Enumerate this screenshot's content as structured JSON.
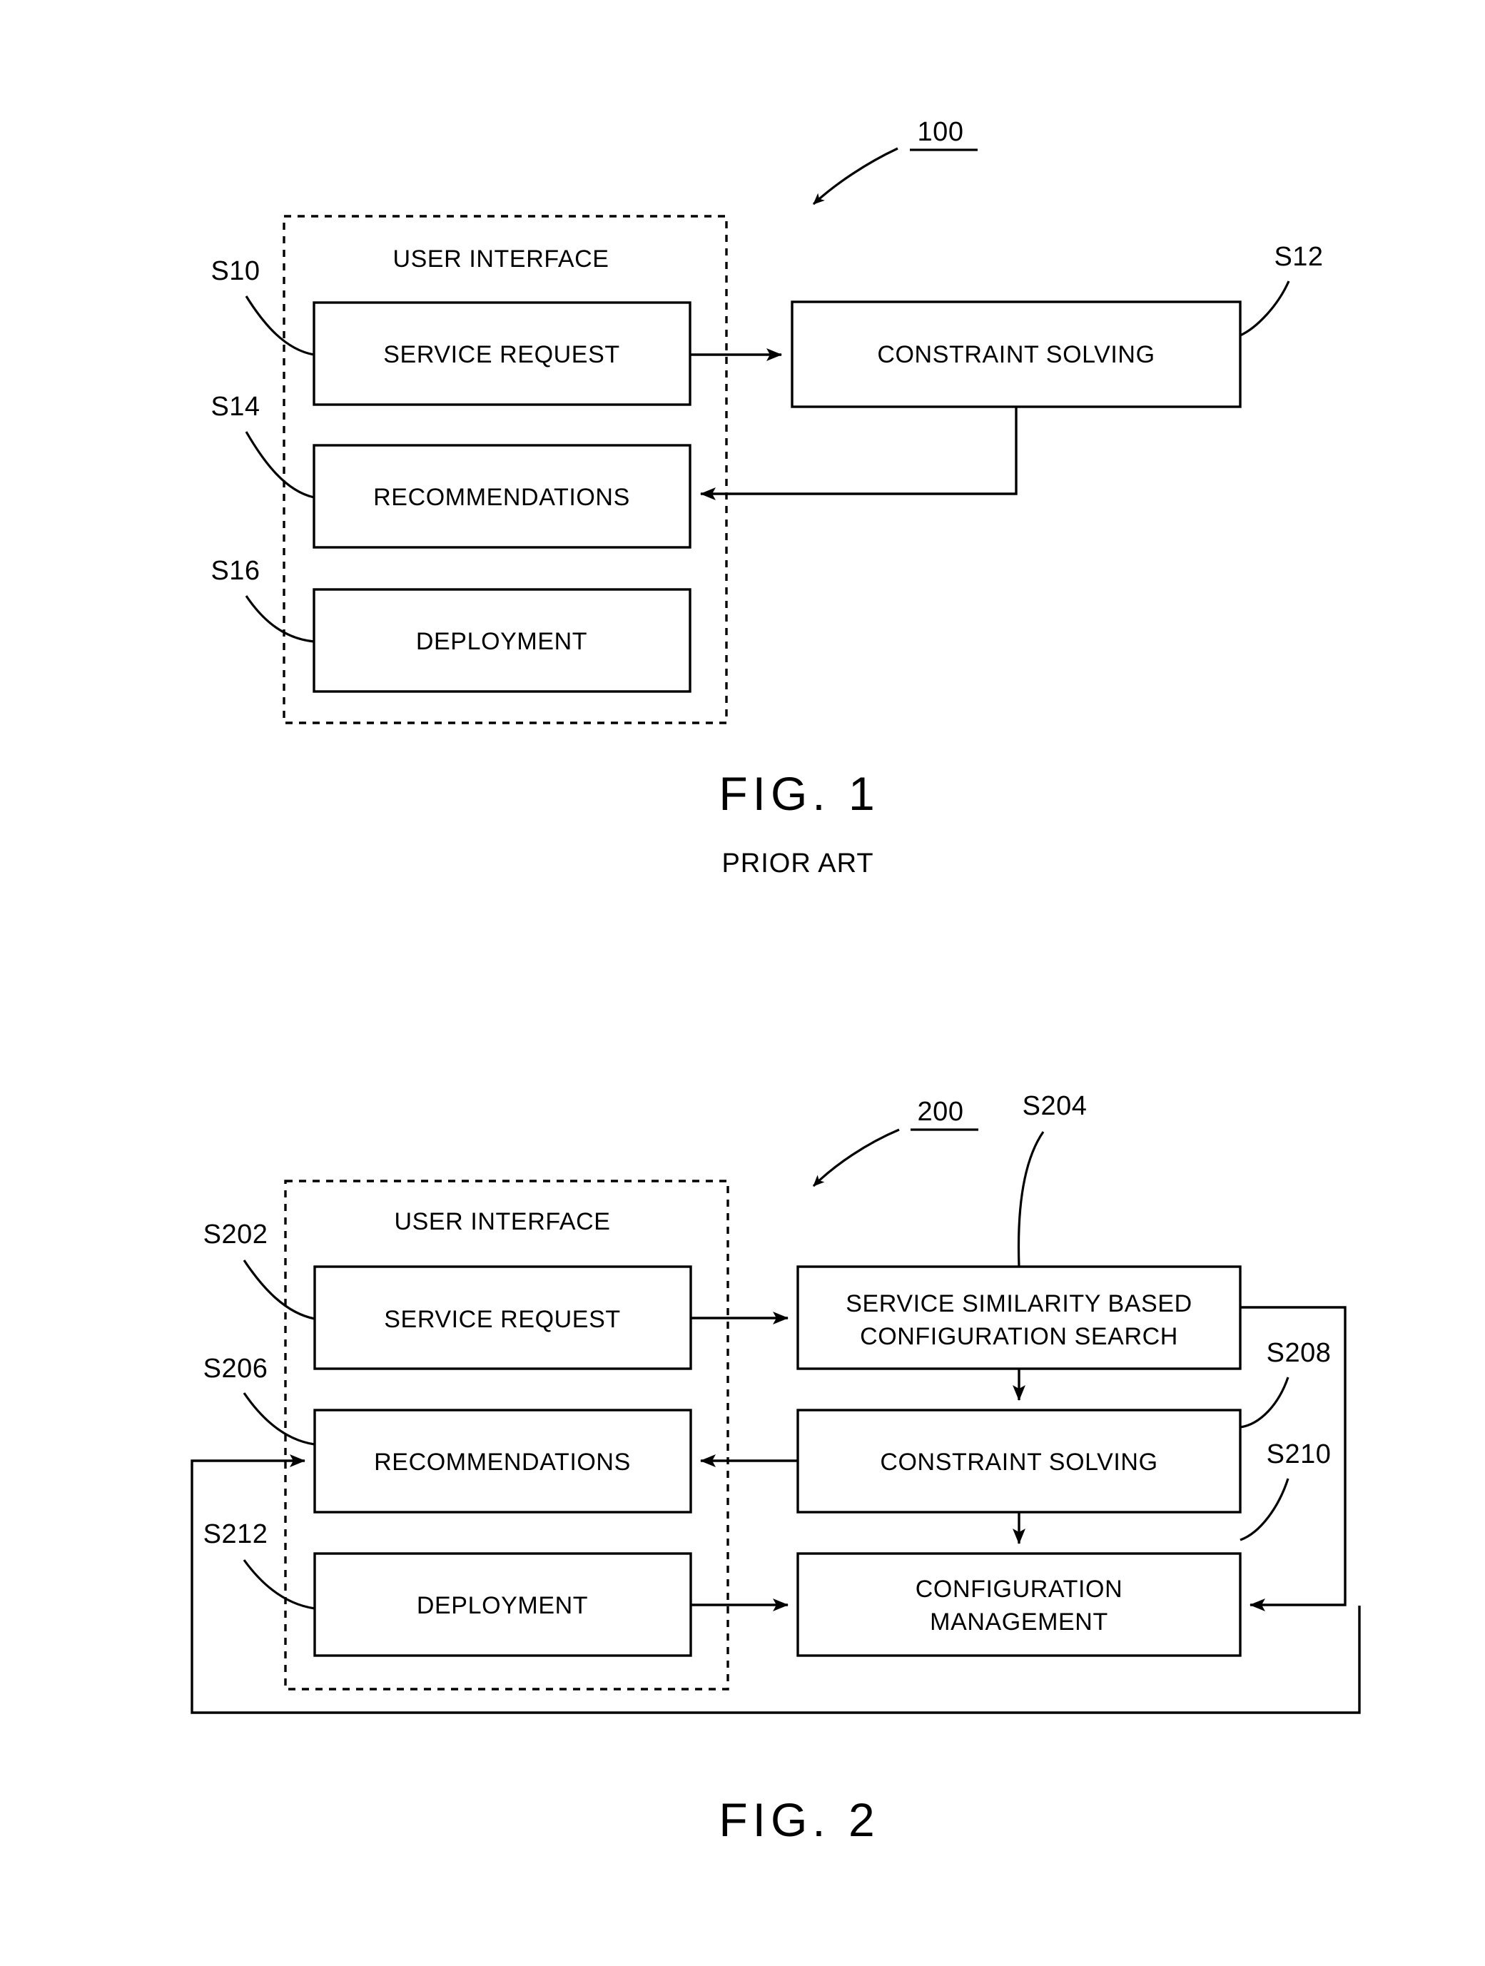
{
  "document": {
    "type": "patent-figure-sheet",
    "figures": [
      {
        "id": "fig1",
        "caption": "FIG. 1",
        "subcaption": "PRIOR ART",
        "system_number": "100",
        "container": {
          "label": "USER INTERFACE",
          "reference": null
        },
        "boxes": [
          {
            "label": "SERVICE REQUEST",
            "reference": "S10"
          },
          {
            "label": "RECOMMENDATIONS",
            "reference": "S14"
          },
          {
            "label": "DEPLOYMENT",
            "reference": "S16"
          },
          {
            "label": "CONSTRAINT SOLVING",
            "reference": "S12"
          }
        ],
        "connections": [
          {
            "from": "SERVICE REQUEST",
            "to": "CONSTRAINT SOLVING",
            "style": "arrow-right"
          },
          {
            "from": "CONSTRAINT SOLVING",
            "to": "RECOMMENDATIONS",
            "style": "feedback-arrow-left"
          }
        ]
      },
      {
        "id": "fig2",
        "caption": "FIG. 2",
        "subcaption": null,
        "system_number": "200",
        "container": {
          "label": "USER INTERFACE",
          "reference": null
        },
        "boxes": [
          {
            "label": "SERVICE REQUEST",
            "reference": "S202"
          },
          {
            "label": "RECOMMENDATIONS",
            "reference": "S206"
          },
          {
            "label": "DEPLOYMENT",
            "reference": "S212"
          },
          {
            "label_line1": "SERVICE SIMILARITY BASED",
            "label_line2": "CONFIGURATION SEARCH",
            "reference": "S204"
          },
          {
            "label": "CONSTRAINT SOLVING",
            "reference": "S208"
          },
          {
            "label_line1": "CONFIGURATION",
            "label_line2": "MANAGEMENT",
            "reference": "S210"
          }
        ],
        "connections": [
          {
            "from": "SERVICE REQUEST",
            "to": "SERVICE SIMILARITY BASED CONFIGURATION SEARCH",
            "style": "arrow-right"
          },
          {
            "from": "SERVICE SIMILARITY BASED CONFIGURATION SEARCH",
            "to": "CONSTRAINT SOLVING",
            "style": "arrow-down"
          },
          {
            "from": "CONSTRAINT SOLVING",
            "to": "RECOMMENDATIONS",
            "style": "arrow-left"
          },
          {
            "from": "CONSTRAINT SOLVING",
            "to": "CONFIGURATION MANAGEMENT",
            "style": "arrow-down"
          },
          {
            "from": "DEPLOYMENT",
            "to": "CONFIGURATION MANAGEMENT",
            "style": "arrow-right"
          },
          {
            "from": "SERVICE SIMILARITY BASED CONFIGURATION SEARCH",
            "to": "CONFIGURATION MANAGEMENT",
            "style": "right-loop-arrow-left"
          },
          {
            "from": "CONFIGURATION MANAGEMENT",
            "to": "RECOMMENDATIONS",
            "style": "outer-loop-arrow-right"
          }
        ]
      }
    ],
    "colors": {
      "ink": "#000000",
      "paper": "#ffffff"
    }
  }
}
